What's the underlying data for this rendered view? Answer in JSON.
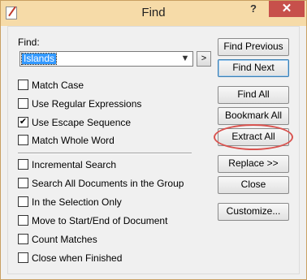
{
  "window": {
    "title": "Find",
    "help_label": "?",
    "close_label": "✕"
  },
  "find": {
    "label": "Find:",
    "value": "Islands",
    "dropdown_arrow": "▼",
    "expand_label": ">"
  },
  "options": [
    {
      "label": "Match Case",
      "checked": false
    },
    {
      "label": "Use Regular Expressions",
      "checked": false
    },
    {
      "label": "Use Escape Sequence",
      "checked": true
    },
    {
      "label": "Match Whole Word",
      "checked": false
    }
  ],
  "options2": [
    {
      "label": "Incremental Search",
      "checked": false
    },
    {
      "label": "Search All Documents in the Group",
      "checked": false
    },
    {
      "label": "In the Selection Only",
      "checked": false
    },
    {
      "label": "Move to Start/End of Document",
      "checked": false
    },
    {
      "label": "Count Matches",
      "checked": false
    },
    {
      "label": "Close when Finished",
      "checked": false
    }
  ],
  "buttons": {
    "find_previous": "Find Previous",
    "find_next": "Find Next",
    "find_all": "Find All",
    "bookmark_all": "Bookmark All",
    "extract_all": "Extract All",
    "replace": "Replace >>",
    "close": "Close",
    "customize": "Customize..."
  },
  "colors": {
    "titlebar": "#f6dba8",
    "close_button": "#c7504b",
    "highlight_ring": "#d9534f",
    "selection": "#3399ff"
  },
  "icons": {
    "check": "✔"
  }
}
